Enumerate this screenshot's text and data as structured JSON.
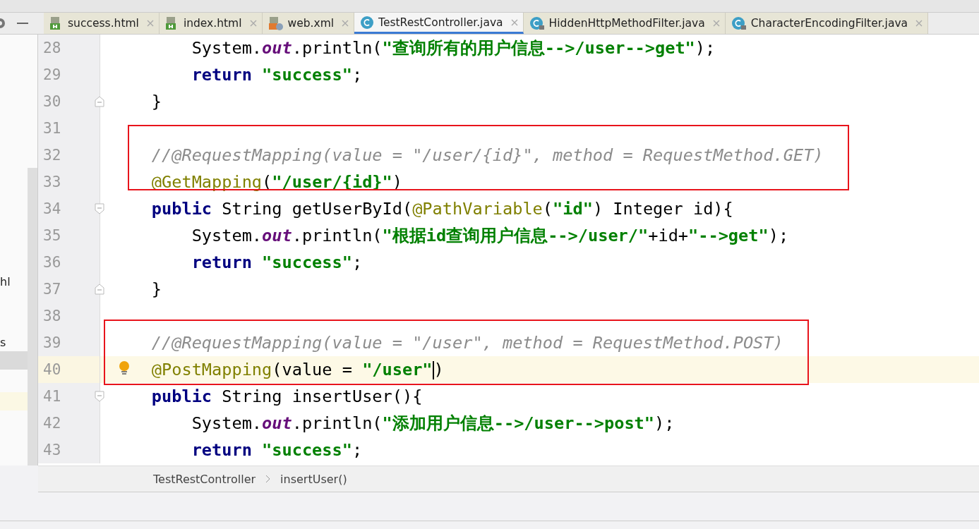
{
  "tabs": [
    {
      "label": "success.html",
      "kind": "html",
      "selected": false
    },
    {
      "label": "index.html",
      "kind": "html",
      "selected": false
    },
    {
      "label": "web.xml",
      "kind": "xml",
      "selected": false
    },
    {
      "label": "TestRestController.java",
      "kind": "class",
      "selected": true
    },
    {
      "label": "HiddenHttpMethodFilter.java",
      "kind": "locked",
      "selected": false
    },
    {
      "label": "CharacterEncodingFilter.java",
      "kind": "locked",
      "selected": false
    }
  ],
  "project_panel": {
    "items": [
      {
        "text": "hl"
      },
      {
        "text": "s"
      }
    ]
  },
  "editor": {
    "lines": [
      {
        "number": "28",
        "kind": "plain",
        "current": false,
        "bulb": false,
        "boxed": false,
        "tokens": [
          {
            "kind": "plain",
            "text": "        System."
          },
          {
            "kind": "field",
            "text": "out"
          },
          {
            "kind": "plain",
            "text": ".println("
          },
          {
            "kind": "string",
            "text": "\"查询所有的用户信息-->/user-->get\""
          },
          {
            "kind": "plain",
            "text": ");"
          }
        ]
      },
      {
        "number": "29",
        "kind": "plain",
        "current": false,
        "bulb": false,
        "boxed": false,
        "tokens": [
          {
            "kind": "keyword",
            "text": "        return"
          },
          {
            "kind": "string",
            "text": " \"success\""
          },
          {
            "kind": "plain",
            "text": ";"
          }
        ]
      },
      {
        "number": "30",
        "kind": "fold_end",
        "current": false,
        "bulb": false,
        "boxed": false,
        "tokens": [
          {
            "kind": "plain",
            "text": "    }"
          }
        ]
      },
      {
        "number": "31",
        "kind": "plain",
        "current": false,
        "bulb": false,
        "boxed": false
      },
      {
        "number": "32",
        "kind": "plain",
        "current": false,
        "bulb": false,
        "boxed": true,
        "tokens": [
          {
            "kind": "comment",
            "text": "    //@RequestMapping(value = \"/user/{id}\", method = RequestMethod.GET)"
          }
        ]
      },
      {
        "number": "33",
        "kind": "plain",
        "current": false,
        "bulb": false,
        "boxed": true,
        "tokens": [
          {
            "kind": "annotation",
            "text": "    @GetMapping"
          },
          {
            "kind": "plain",
            "text": "("
          },
          {
            "kind": "string",
            "text": "\"/user/{id}\""
          },
          {
            "kind": "plain",
            "text": ")"
          }
        ]
      },
      {
        "number": "34",
        "kind": "fold_start",
        "current": false,
        "bulb": false,
        "boxed": false,
        "tokens": [
          {
            "kind": "keyword",
            "text": "    public"
          },
          {
            "kind": "plain",
            "text": " String getUserById("
          },
          {
            "kind": "annotation",
            "text": "@PathVariable"
          },
          {
            "kind": "plain",
            "text": "("
          },
          {
            "kind": "string",
            "text": "\"id\""
          },
          {
            "kind": "plain",
            "text": ") Integer id){"
          }
        ]
      },
      {
        "number": "35",
        "kind": "plain",
        "current": false,
        "bulb": false,
        "boxed": false,
        "tokens": [
          {
            "kind": "plain",
            "text": "        System."
          },
          {
            "kind": "field",
            "text": "out"
          },
          {
            "kind": "plain",
            "text": ".println("
          },
          {
            "kind": "string",
            "text": "\"根据id查询用户信息-->/user/\""
          },
          {
            "kind": "plain",
            "text": "+id+"
          },
          {
            "kind": "string",
            "text": "\"-->get\""
          },
          {
            "kind": "plain",
            "text": ");"
          }
        ]
      },
      {
        "number": "36",
        "kind": "plain",
        "current": false,
        "bulb": false,
        "boxed": false,
        "tokens": [
          {
            "kind": "keyword",
            "text": "        return"
          },
          {
            "kind": "string",
            "text": " \"success\""
          },
          {
            "kind": "plain",
            "text": ";"
          }
        ]
      },
      {
        "number": "37",
        "kind": "fold_end",
        "current": false,
        "bulb": false,
        "boxed": false,
        "tokens": [
          {
            "kind": "plain",
            "text": "    }"
          }
        ]
      },
      {
        "number": "38",
        "kind": "plain",
        "current": false,
        "bulb": false,
        "boxed": false
      },
      {
        "number": "39",
        "kind": "plain",
        "current": false,
        "bulb": false,
        "boxed": true,
        "tokens": [
          {
            "kind": "comment",
            "text": "    //@RequestMapping(value = \"/user\", method = RequestMethod.POST)"
          }
        ]
      },
      {
        "number": "40",
        "kind": "plain",
        "current": true,
        "bulb": true,
        "boxed": true,
        "tokens": [
          {
            "kind": "annotation",
            "text": "    @PostMapping"
          },
          {
            "kind": "plain",
            "text": "(value = "
          },
          {
            "kind": "string",
            "text": "\"/user\""
          },
          {
            "kind": "caret"
          },
          {
            "kind": "plain",
            "text": ")"
          }
        ]
      },
      {
        "number": "41",
        "kind": "fold_start",
        "current": false,
        "bulb": false,
        "boxed": false,
        "tokens": [
          {
            "kind": "keyword",
            "text": "    public"
          },
          {
            "kind": "plain",
            "text": " String insertUser(){"
          }
        ]
      },
      {
        "number": "42",
        "kind": "plain",
        "current": false,
        "bulb": false,
        "boxed": false,
        "tokens": [
          {
            "kind": "plain",
            "text": "        System."
          },
          {
            "kind": "field",
            "text": "out"
          },
          {
            "kind": "plain",
            "text": ".println("
          },
          {
            "kind": "string",
            "text": "\"添加用户信息-->/user-->post\""
          },
          {
            "kind": "plain",
            "text": ");"
          }
        ]
      },
      {
        "number": "43",
        "kind": "plain",
        "current": false,
        "bulb": false,
        "boxed": false,
        "tokens": [
          {
            "kind": "keyword",
            "text": "        return"
          },
          {
            "kind": "string",
            "text": " \"success\""
          },
          {
            "kind": "plain",
            "text": ";"
          }
        ]
      }
    ]
  },
  "breadcrumb": [
    "TestRestController",
    "insertUser()"
  ]
}
